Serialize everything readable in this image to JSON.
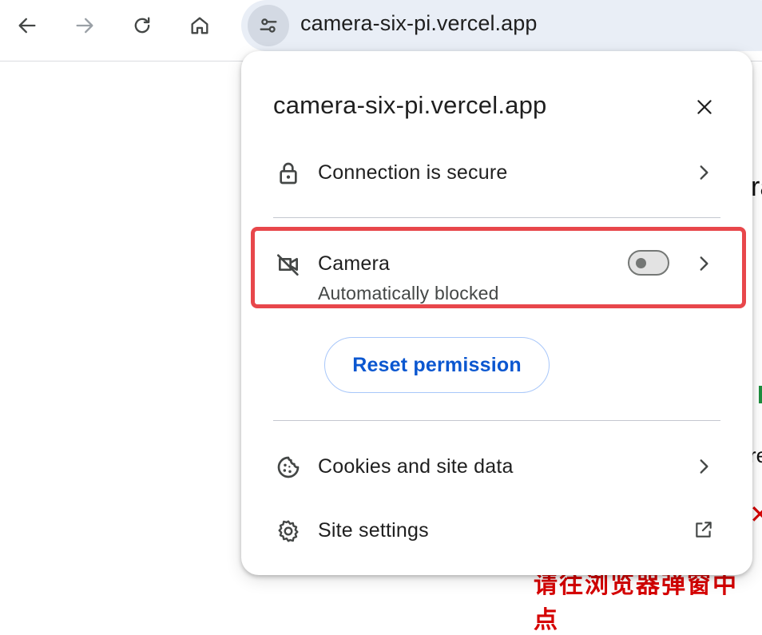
{
  "toolbar": {
    "back_icon": "arrow-left-icon",
    "forward_icon": "arrow-right-icon",
    "reload_icon": "reload-icon",
    "home_icon": "home-icon",
    "site_info_icon": "tune-icon",
    "url": "camera-six-pi.vercel.app"
  },
  "popup": {
    "title": "camera-six-pi.vercel.app",
    "close_icon": "close-icon",
    "connection": {
      "icon": "lock-icon",
      "label": "Connection is secure"
    },
    "camera": {
      "icon": "camera-off-icon",
      "label": "Camera",
      "status": "Automatically blocked",
      "toggle_on": false
    },
    "reset_button": "Reset permission",
    "cookies": {
      "icon": "cookie-icon",
      "label": "Cookies and site data"
    },
    "site_settings": {
      "icon": "gear-icon",
      "label": "Site settings",
      "external_icon": "open-in-new-icon"
    }
  },
  "colors": {
    "highlight": "#e8474b",
    "accent": "#0b57d0",
    "omnibox_bg": "#e9eef6"
  }
}
